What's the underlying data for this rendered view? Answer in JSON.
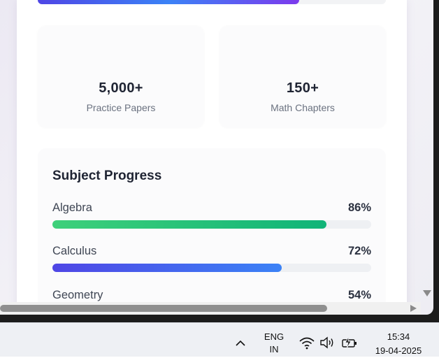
{
  "top_progress": {
    "fraction": 0.75
  },
  "stats": [
    {
      "value": "5,000+",
      "label": "Practice Papers"
    },
    {
      "value": "150+",
      "label": "Math Chapters"
    }
  ],
  "subject_progress": {
    "title": "Subject Progress",
    "subjects": [
      {
        "name": "Algebra",
        "percent_label": "86%",
        "percent": 86,
        "gradient": [
          "#3ed07a",
          "#10b478"
        ]
      },
      {
        "name": "Calculus",
        "percent_label": "72%",
        "percent": 72,
        "gradient": [
          "#4f46e5",
          "#3b82f6"
        ]
      },
      {
        "name": "Geometry",
        "percent_label": "54%",
        "percent": 54,
        "gradient": [
          "#f59e0b",
          "#f97316"
        ]
      }
    ]
  },
  "taskbar": {
    "lang_line1": "ENG",
    "lang_line2": "IN",
    "time": "15:34",
    "date": "19-04-2025",
    "icons": [
      "chevron-up-icon",
      "wifi-icon",
      "speaker-icon",
      "battery-charging-icon"
    ]
  }
}
